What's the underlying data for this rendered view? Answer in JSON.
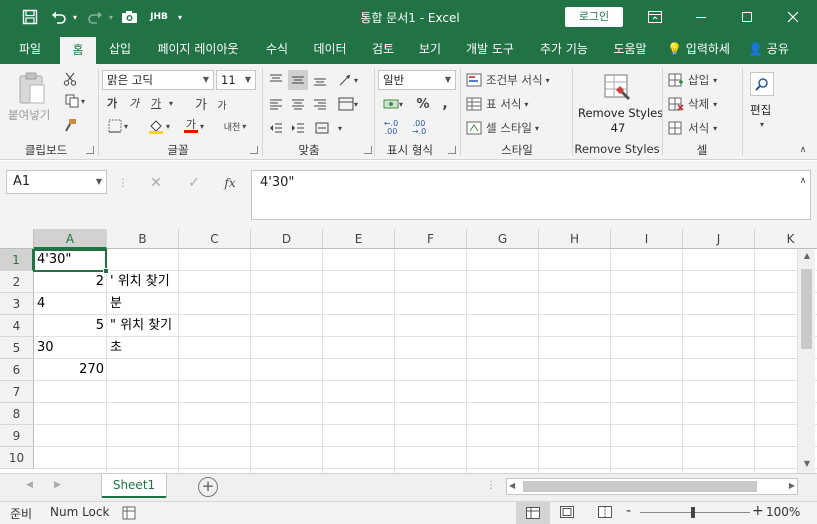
{
  "titlebar": {
    "title": "통합 문서1 - Excel",
    "login": "로그인",
    "qat_custom_label": "JHB"
  },
  "tabs": [
    "파일",
    "홈",
    "삽입",
    "페이지 레이아웃",
    "수식",
    "데이터",
    "검토",
    "보기",
    "개발 도구",
    "추가 기능",
    "도움말"
  ],
  "active_tab": "홈",
  "tell_me": "입력하세",
  "share": "공유",
  "ribbon": {
    "clipboard": {
      "paste": "붙여넣기",
      "label": "클립보드"
    },
    "font": {
      "name": "맑은 고딕",
      "size": "11",
      "bold": "가",
      "italic": "가",
      "underline": "가",
      "grow": "가",
      "shrink": "가",
      "phonetic": "내천",
      "color_letter": "가",
      "label": "글꼴"
    },
    "alignment": {
      "label": "맞춤"
    },
    "number": {
      "format": "일반",
      "label": "표시 형식"
    },
    "styles": {
      "conditional": "조건부 서식",
      "table": "표 서식",
      "cell": "셀 스타일",
      "label": "스타일"
    },
    "remove_styles": {
      "line1": "Remove Styles",
      "line2": "47",
      "label": "Remove Styles"
    },
    "cells": {
      "insert": "삽입",
      "delete": "삭제",
      "format": "서식",
      "label": "셀"
    },
    "editing": {
      "label": "편집"
    }
  },
  "formula_bar": {
    "name_box": "A1",
    "content": "4'30\""
  },
  "grid": {
    "columns": [
      "A",
      "B",
      "C",
      "D",
      "E",
      "F",
      "G",
      "H",
      "I",
      "J",
      "K"
    ],
    "rows": [
      "1",
      "2",
      "3",
      "4",
      "5",
      "6",
      "7",
      "8",
      "9",
      "10"
    ],
    "cells": {
      "A1": "4'30\"",
      "A2": "2",
      "B2": "' 위치 찾기",
      "A3": "4",
      "B3": "분",
      "A4": "5",
      "B4": "\" 위치 찾기",
      "A5": "30",
      "B5": "초",
      "A6": "270"
    }
  },
  "sheets": [
    "Sheet1"
  ],
  "status": {
    "ready": "준비",
    "num_lock": "Num Lock",
    "zoom": "100%",
    "zoom_minus": "-",
    "zoom_plus": "+"
  },
  "colors": {
    "brand": "#217346",
    "ribbon": "#f3f3f3"
  }
}
